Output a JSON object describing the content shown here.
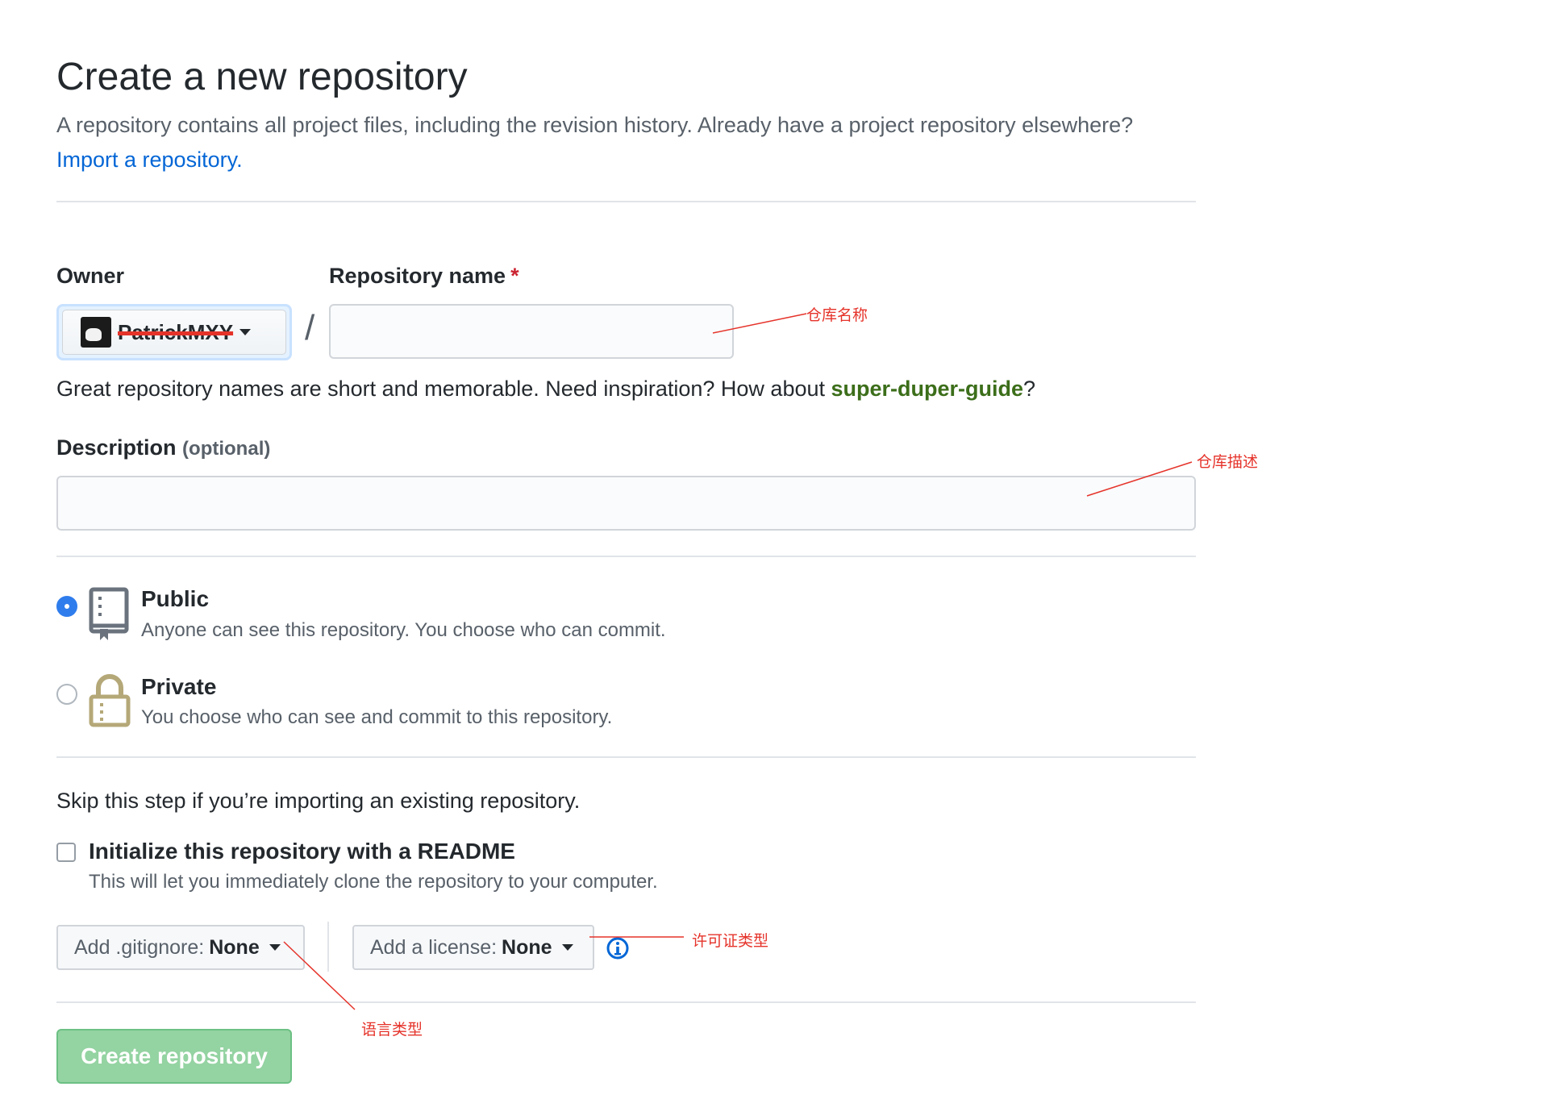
{
  "header": {
    "title": "Create a new repository",
    "subtitle": "A repository contains all project files, including the revision history. Already have a project repository elsewhere?",
    "import_link": "Import a repository."
  },
  "form": {
    "owner_label": "Owner",
    "owner_value": "PatrickMXY",
    "slash": "/",
    "repo_name_label": "Repository name",
    "required_mark": "*",
    "repo_name_value": "",
    "hint_text": "Great repository names are short and memorable. Need inspiration? How about",
    "hint_suggestion": "super-duper-guide",
    "hint_end": "?",
    "description_label": "Description",
    "description_optional": "(optional)",
    "description_value": ""
  },
  "visibility": {
    "selected": "public",
    "public_title": "Public",
    "public_desc": "Anyone can see this repository. You choose who can commit.",
    "private_title": "Private",
    "private_desc": "You choose who can see and commit to this repository."
  },
  "init": {
    "skip_text": "Skip this step if you’re importing an existing repository.",
    "readme_label": "Initialize this repository with a README",
    "readme_checked": false,
    "readme_desc": "This will let you immediately clone the repository to your computer.",
    "gitignore_label": "Add .gitignore:",
    "gitignore_value": "None",
    "license_label": "Add a license:",
    "license_value": "None"
  },
  "submit": {
    "create_label": "Create repository"
  },
  "annotations": {
    "repo_name": "仓库名称",
    "description": "仓库描述",
    "license": "许可证类型",
    "gitignore": "语言类型"
  },
  "colors": {
    "link": "#0366d6",
    "suggestion": "#3c6e1a",
    "required": "#cb2431",
    "radio_selected": "#2f7ded",
    "create_button": "#94d3a2",
    "annotation": "#e5332a"
  },
  "icons": {
    "public": "repo-book-icon",
    "private": "lock-icon",
    "info": "info-icon",
    "caret": "caret-down-icon"
  }
}
